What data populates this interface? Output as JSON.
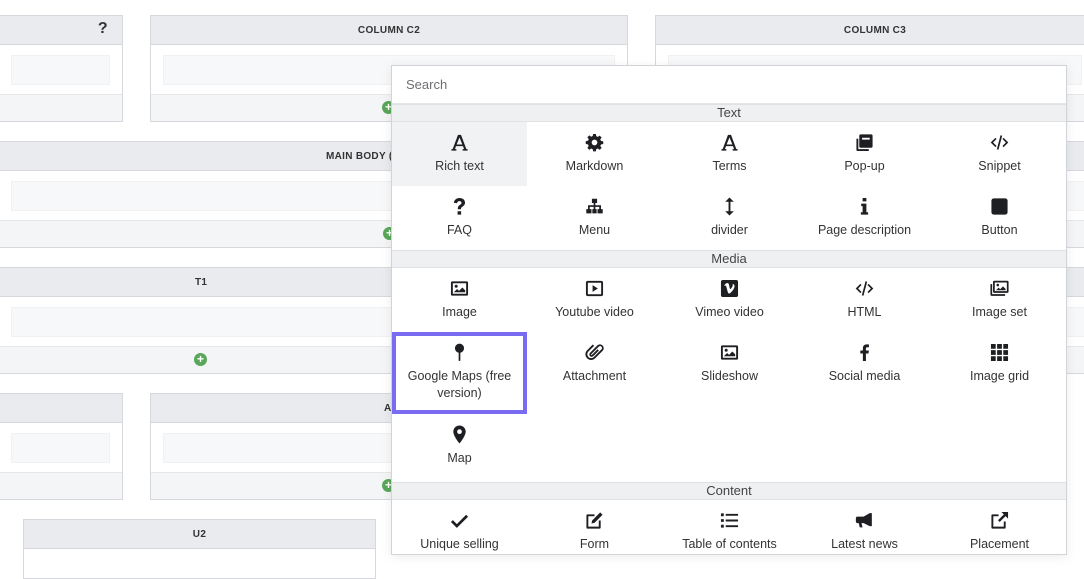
{
  "background": {
    "col1_help": "?",
    "col2_title": "COLUMN C2",
    "col3_title": "COLUMN C3",
    "main_body_title": "MAIN BODY (",
    "t1_title": "T1",
    "a_title": "A",
    "u2_title": "U2"
  },
  "popup": {
    "search_placeholder": "Search",
    "categories": {
      "text": "Text",
      "media": "Media",
      "content": "Content"
    },
    "text_items": [
      "Rich text",
      "Markdown",
      "Terms",
      "Pop-up",
      "Snippet",
      "FAQ",
      "Menu",
      "divider",
      "Page description",
      "Button"
    ],
    "media_items": [
      "Image",
      "Youtube video",
      "Vimeo video",
      "HTML",
      "Image set",
      "Google Maps (free version)",
      "Attachment",
      "Slideshow",
      "Social media",
      "Image grid",
      "Map"
    ],
    "content_items": [
      "Unique selling",
      "Form",
      "Table of contents",
      "Latest news",
      "Placement"
    ]
  },
  "colors": {
    "highlight": "#7a6cf0",
    "plus": "#5aa65a"
  }
}
